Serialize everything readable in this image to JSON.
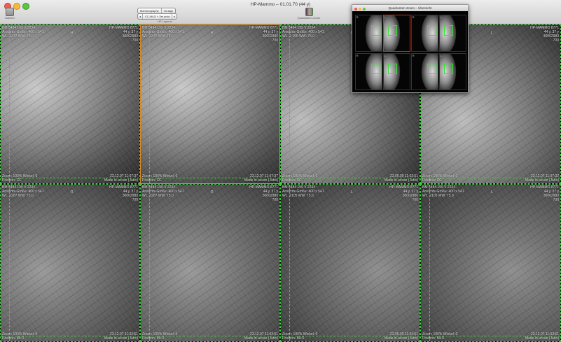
{
  "window": {
    "title": "HP-Mammo – 01.01.70 (44 y)"
  },
  "toolbar": {
    "dateien_label": "Dateien",
    "mammo_segments": [
      "Mammography",
      "Voriage"
    ],
    "layout_segments": [
      "CC-MLO + 2er prior"
    ],
    "hp_layouts_label": "HP Layouts",
    "quadrant_zoom_label": "Quadranten-Zoom"
  },
  "overview_panel": {
    "title": "Quadranten-Zoom – Übersicht",
    "thumb_labels": [
      "R",
      "L",
      "R",
      "L"
    ]
  },
  "tiles": [
    {
      "tl": "BM 5484 199 V 2234\nAnsichts-Größe: 400 x 541\nWL: 2377 WW: 75.0",
      "tr": "HP-MAMMO 8771\n44 y, 37 y\n30002980\n700",
      "bl": "Zoom: 100% Winkel: 0\nPosition: CC",
      "br": "23.12.07 11:07:37\nMade in accan (Jaho)",
      "marker": "R"
    },
    {
      "tl": "BM 5484 199 V 2234\nAnsichts-Größe: 400 x 541\nWL: 2377 WW: 75.0",
      "tr": "HP-MAMMO 8771\n44 y, 37 y\n30002980\n700",
      "bl": "Zoom: 100% Winkel: 0\nPosition: CC",
      "br": "23.12.07 11:07:37\nMade in accan (Jaho)",
      "marker": "R"
    },
    {
      "tl": "BM 5484 199 V 2234\nAnsichts-Größe: 400 x 541\nWL: 2 105 WW: 75.0",
      "tr": "HP-MAMMO 8771\n44 y, 37 y\n30002980\n700",
      "bl": "Zoom: 100% Winkel: 0\nPosition: CC",
      "br": "23.06.09 11:03:51\nMade in accan (Jaho)",
      "marker": "L"
    },
    {
      "tl": "BM 5484 199 V 2234\nAnsichts-Größe: 400 x 541\nWL: 2377 WW: 75.0",
      "tr": "HP-MAMMO 8771\n44 y, 37 y\n30002980\n700",
      "bl": "Zoom: 100% Winkel: 0\nPosition: CC",
      "br": "23.12.07 11:07:32\nMade in accan (Jaho)",
      "marker": "L"
    },
    {
      "tl": "BM 5484 199 V 2234\nAnsichts-Größe: 400 x 541\nWL: 2287 WW: 75.0",
      "tr": "HP-MAMMO 8771\n44 y, 37 y\n30002980\n700",
      "bl": "Zoom: 100% Winkel: 0\nPosition: MLO",
      "br": "23.12.07 11:03:51\nMade in accan (Jaho)",
      "marker": "R"
    },
    {
      "tl": "BM 5484 199 V 2234\nAnsichts-Größe: 400 x 541\nWL: 2287 WW: 75.0",
      "tr": "HP-MAMMO 8771\n44 y, 37 y\n30002980\n700",
      "bl": "Zoom: 100% Winkel: 0\nPosition: MLO",
      "br": "23.12.07 11:03:51\nMade in accan (Jaho)",
      "marker": "R"
    },
    {
      "tl": "BM 5484 199 V 2234\nAnsichts-Größe: 400 x 541\nWL: 2105 WW: 75.0",
      "tr": "HP-MAMMO 8771\n44 y, 37 y\n30002980\n700",
      "bl": "Zoom: 100% Winkel: 0\nPosition: MLO",
      "br": "23.06.09 11:03:51\nMade in accan (Jaho)",
      "marker": "L"
    },
    {
      "tl": "BM 5484 199 V 2234\nAnsichts-Größe: 400 x 541\nWL: 2105 WW: 75.0",
      "tr": "HP-MAMMO 8771\n44 y, 37 y\n30002980\n700",
      "bl": "Zoom: 100% Winkel: 0\nPosition: MLO",
      "br": "23.12.07 11:03:51\nMade in accan (Jaho)",
      "marker": "L"
    }
  ],
  "colors": {
    "viewport_border": "#3ccf3c",
    "selected_border": "#d88a1c",
    "overview_selected": "#c4361d"
  }
}
